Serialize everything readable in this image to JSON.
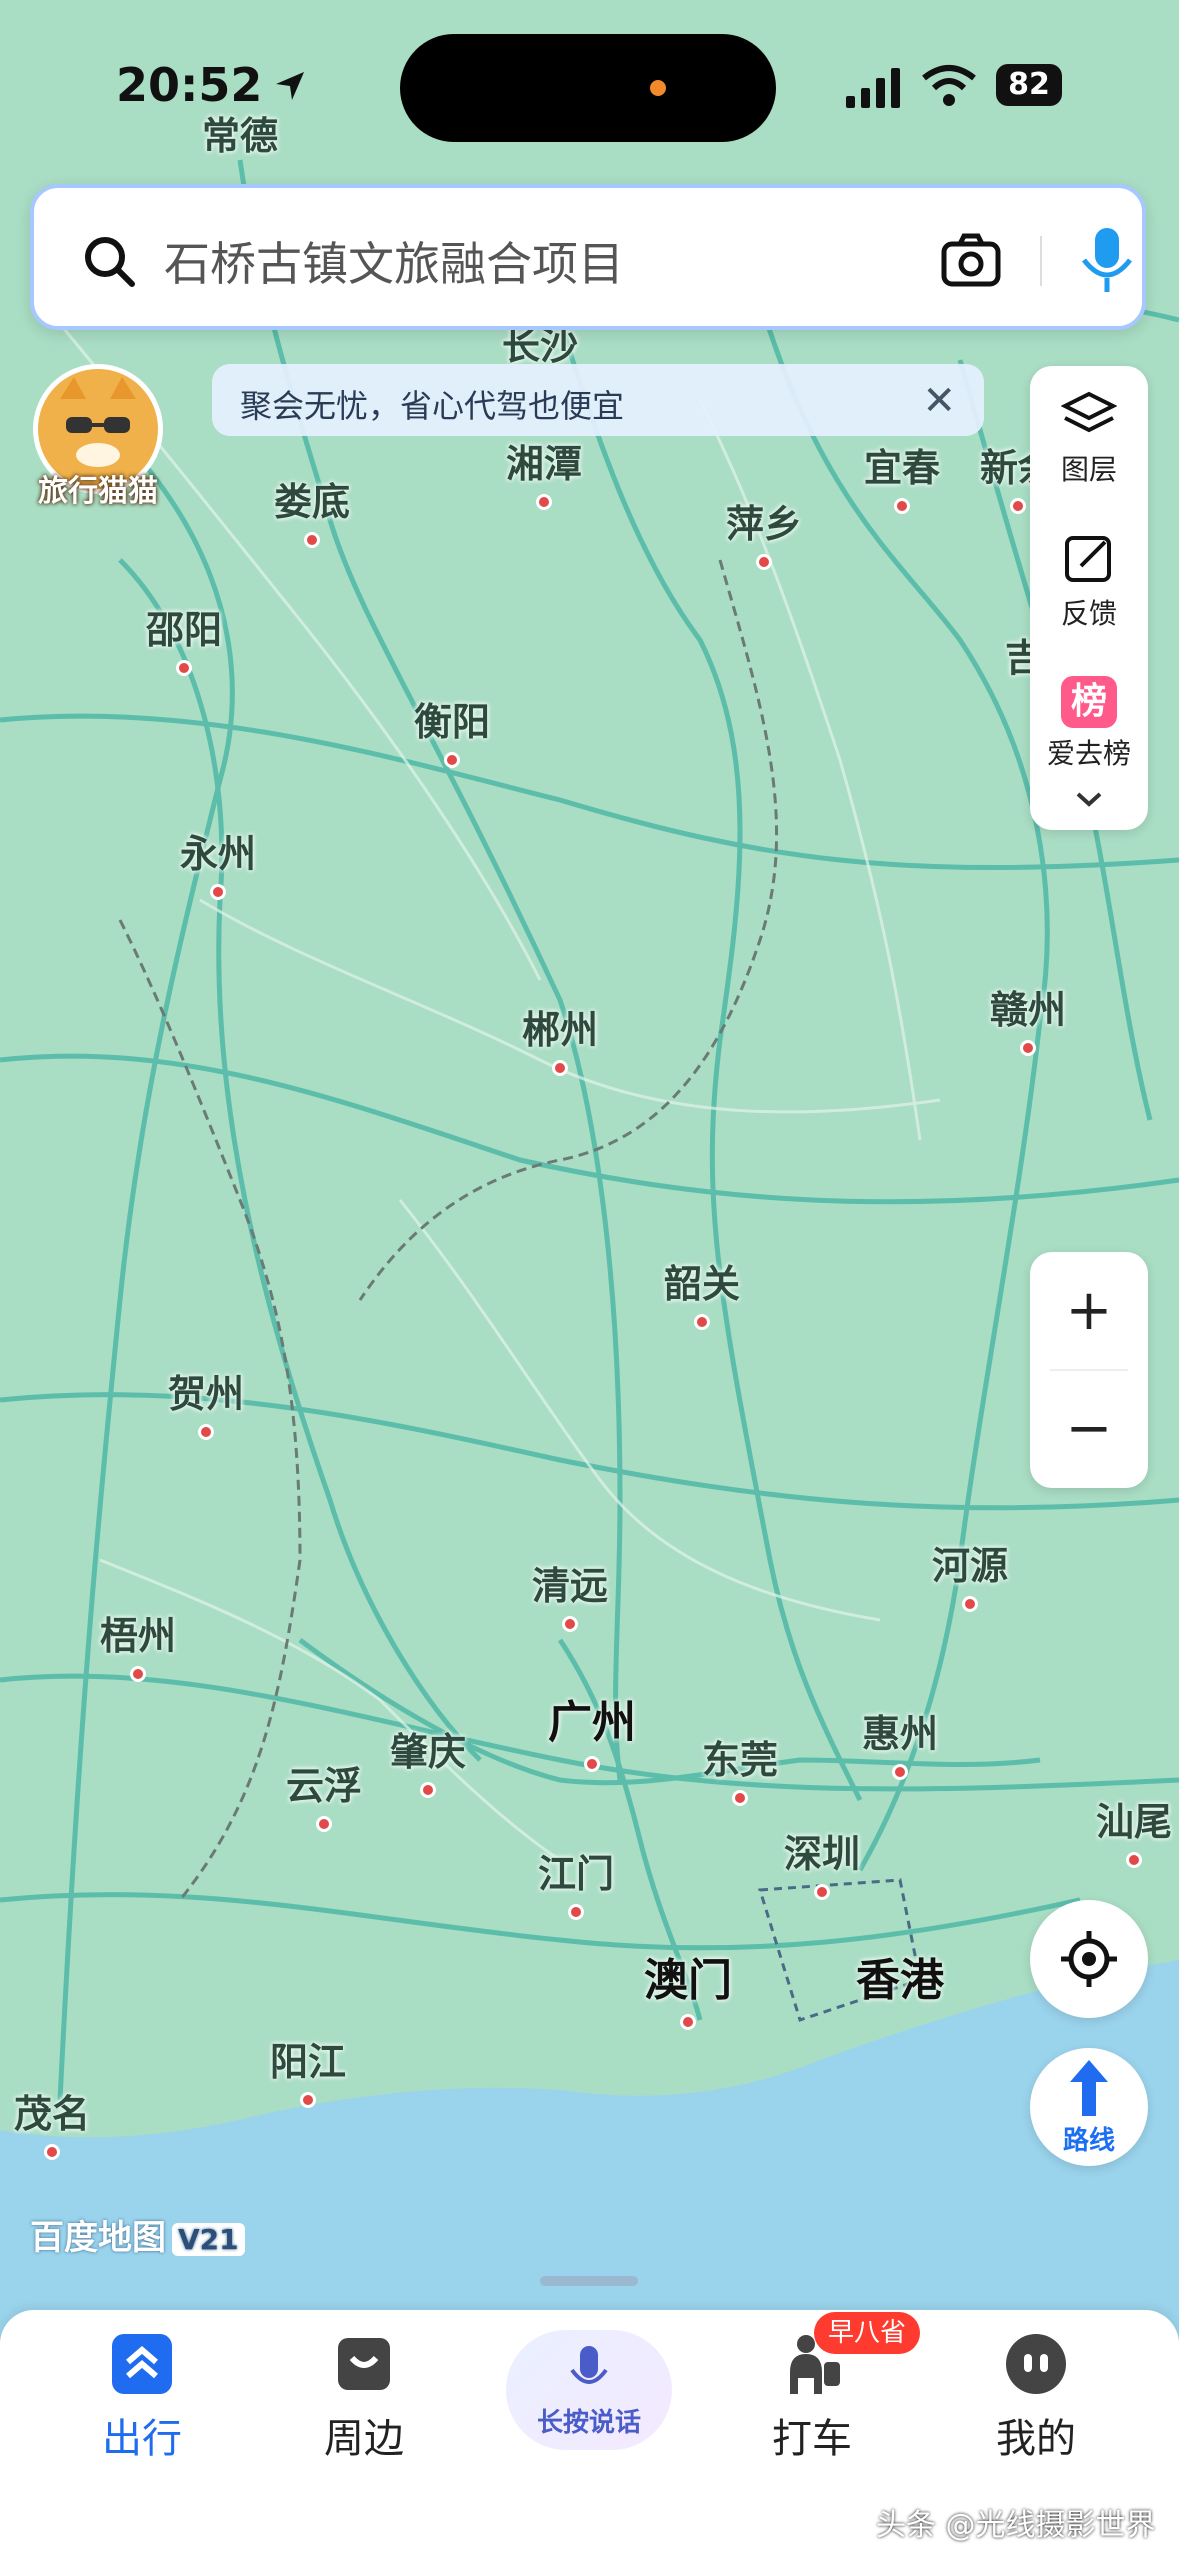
{
  "status": {
    "time": "20:52",
    "battery": "82"
  },
  "search": {
    "placeholder": "石桥古镇文旅融合项目"
  },
  "notice": {
    "text": "聚会无忧，省心代驾也便宜",
    "close": "✕"
  },
  "mascot": {
    "label": "旅行猫猫"
  },
  "right_panel": {
    "layers": "图层",
    "feedback": "反馈",
    "rank_badge": "榜",
    "rank": "爱去榜"
  },
  "zoom": {
    "in": "+",
    "out": "−"
  },
  "route": {
    "label": "路线"
  },
  "map_logo": {
    "name": "百度地图",
    "version": "V21"
  },
  "cities": [
    {
      "name": "常德"
    },
    {
      "name": "长沙"
    },
    {
      "name": "湘潭"
    },
    {
      "name": "娄底"
    },
    {
      "name": "宜春"
    },
    {
      "name": "新余"
    },
    {
      "name": "萍乡"
    },
    {
      "name": "邵阳"
    },
    {
      "name": "衡阳"
    },
    {
      "name": "吉"
    },
    {
      "name": "永州"
    },
    {
      "name": "郴州"
    },
    {
      "name": "赣州"
    },
    {
      "name": "韶关"
    },
    {
      "name": "贺州"
    },
    {
      "name": "清远"
    },
    {
      "name": "河源"
    },
    {
      "name": "梧州"
    },
    {
      "name": "惠州"
    },
    {
      "name": "肇庆"
    },
    {
      "name": "广州"
    },
    {
      "name": "东莞"
    },
    {
      "name": "云浮"
    },
    {
      "name": "汕尾"
    },
    {
      "name": "江门"
    },
    {
      "name": "深圳"
    },
    {
      "name": "澳门"
    },
    {
      "name": "香港"
    },
    {
      "name": "阳江"
    },
    {
      "name": "茂名"
    }
  ],
  "nav": [
    {
      "label": "出行"
    },
    {
      "label": "周边"
    },
    {
      "label": "长按说话"
    },
    {
      "label": "打车"
    },
    {
      "label": "我的"
    }
  ],
  "taxi_badge": "早八省",
  "watermark": "头条 @光线摄影世界",
  "colors": {
    "land": "#a9ddc4",
    "sea": "#9ad3ec",
    "road": "#4fb8a6",
    "accent": "#1f6cf0",
    "city_dot": "#e24a4a"
  }
}
